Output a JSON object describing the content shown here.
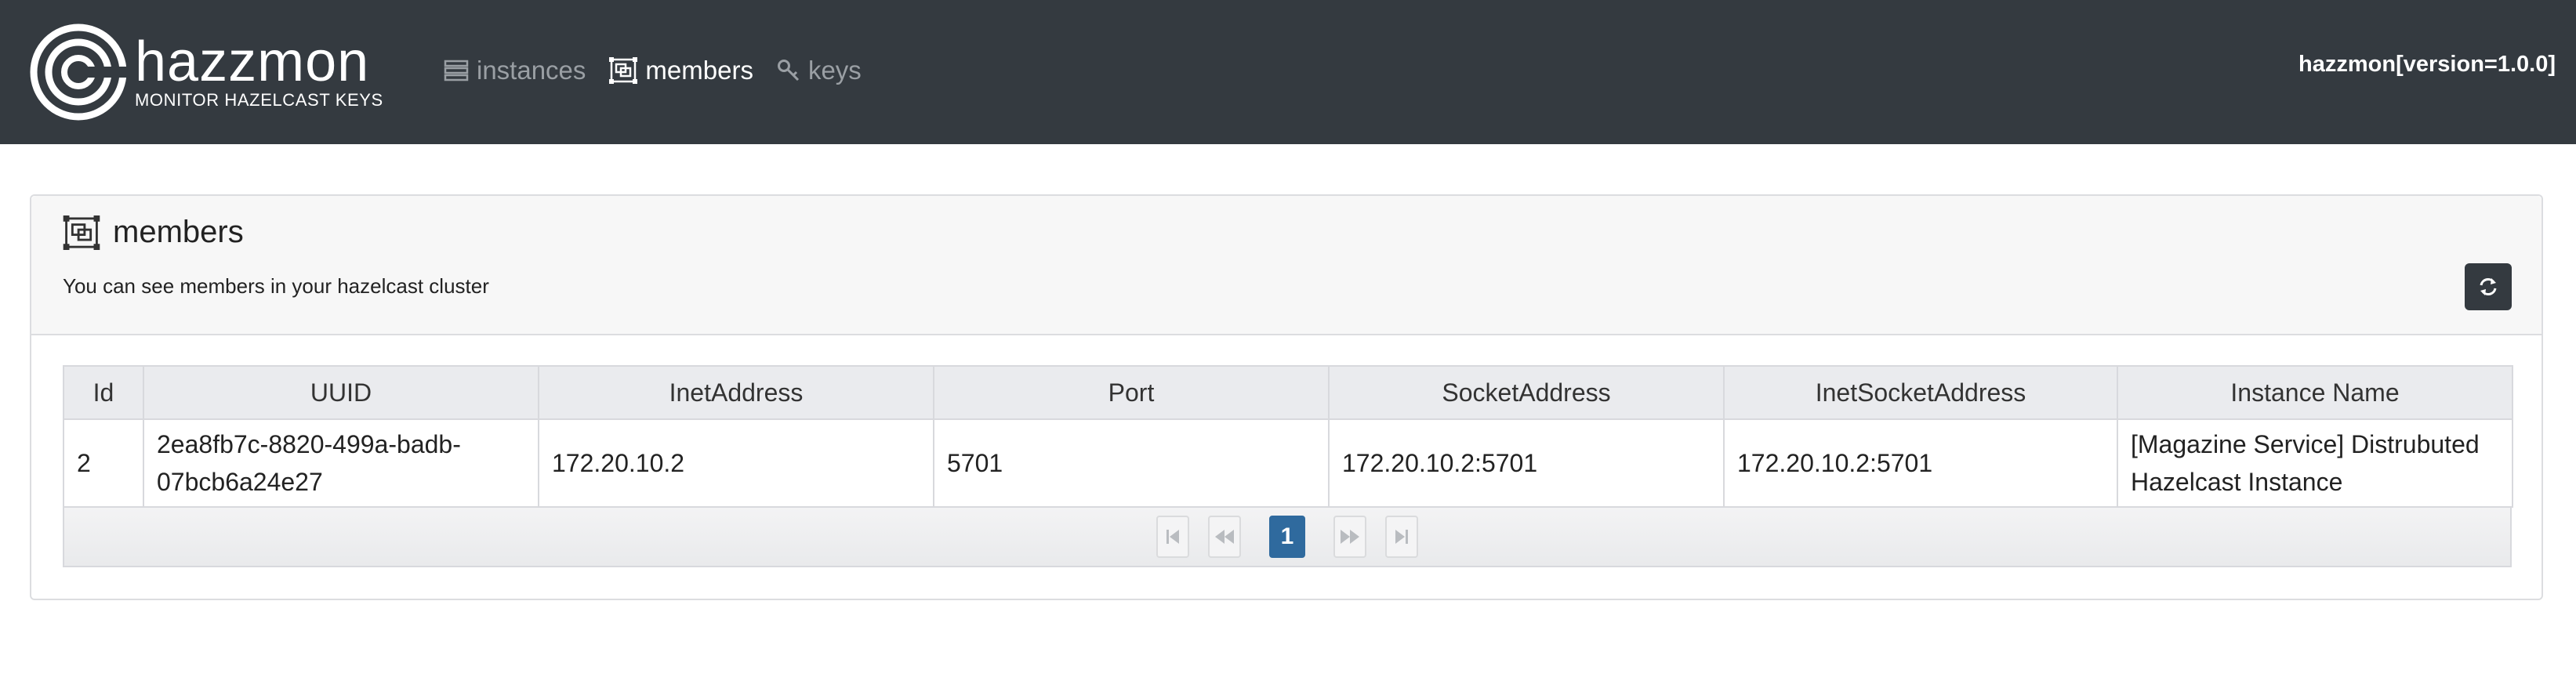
{
  "navbar": {
    "brand_name": "hazzmon",
    "brand_subtitle": "MONITOR HAZELCAST KEYS",
    "items": [
      {
        "label": "instances",
        "icon": "server-icon",
        "active": false
      },
      {
        "label": "members",
        "icon": "members-icon",
        "active": true
      },
      {
        "label": "keys",
        "icon": "key-icon",
        "active": false
      }
    ],
    "version_text": "hazzmon[version=1.0.0]"
  },
  "card": {
    "title": "members",
    "title_icon": "members-icon",
    "description": "You can see members in your hazelcast cluster",
    "refresh_icon": "refresh-icon"
  },
  "table": {
    "columns": [
      "Id",
      "UUID",
      "InetAddress",
      "Port",
      "SocketAddress",
      "InetSocketAddress",
      "Instance Name"
    ],
    "rows": [
      [
        "2",
        "2ea8fb7c-8820-499a-badb-07bcb6a24e27",
        "172.20.10.2",
        "5701",
        "172.20.10.2:5701",
        "172.20.10.2:5701",
        "[Magazine Service] Distrubuted Hazelcast Instance"
      ]
    ]
  },
  "pagination": {
    "current_page": "1",
    "buttons": [
      "first-page-icon",
      "prev-page-icon",
      "next-page-icon",
      "last-page-icon"
    ]
  },
  "colors": {
    "navbar_bg": "#343a40",
    "active_page": "#2f6a9e"
  }
}
